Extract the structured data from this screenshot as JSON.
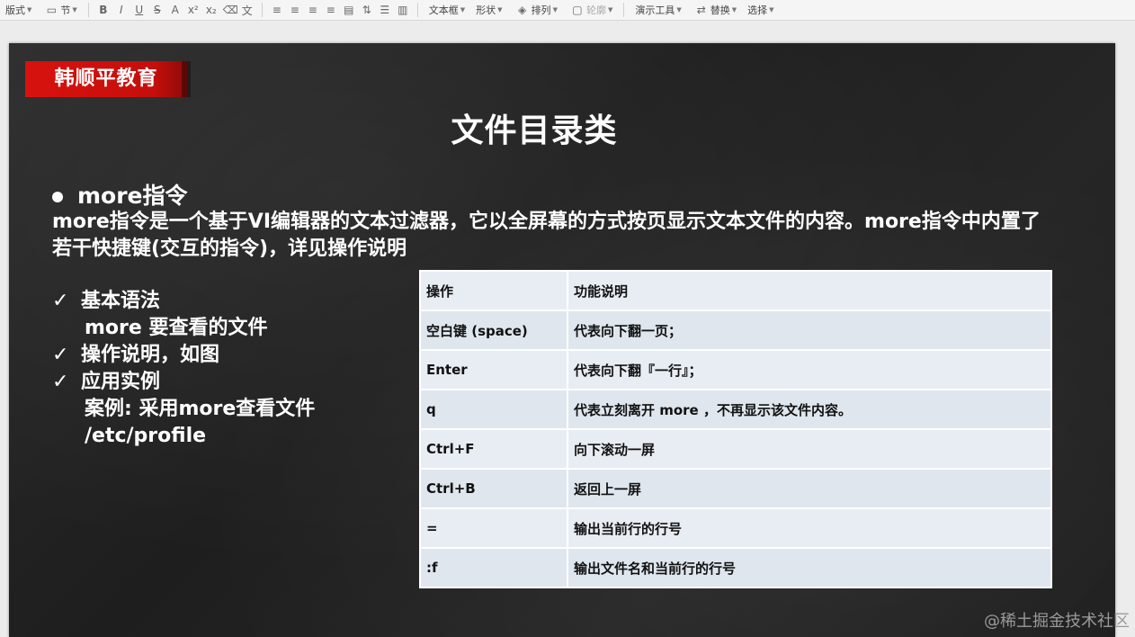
{
  "toolbar": {
    "items": [
      "版式",
      "节"
    ],
    "textbox": "文本框",
    "shape": "形状",
    "arrange": "排列",
    "outline": "轮廓",
    "present_tools": "演示工具",
    "replace": "替换",
    "select": "选择"
  },
  "slide": {
    "logo": "韩顺平教育",
    "title": "文件目录类",
    "heading": "more指令",
    "description": "more指令是一个基于VI编辑器的文本过滤器，它以全屏幕的方式按页显示文本文件的内容。more指令中内置了若干快捷键(交互的指令)，详见操作说明",
    "list": [
      {
        "check": "✓",
        "text": "基本语法"
      },
      {
        "check": "",
        "text": "more 要查看的文件"
      },
      {
        "check": "✓",
        "text": "操作说明，如图"
      },
      {
        "check": "✓",
        "text": "应用实例"
      },
      {
        "check": "",
        "text": "案例: 采用more查看文件"
      },
      {
        "check": "",
        "text": "/etc/profile"
      }
    ],
    "table": [
      [
        "操作",
        "功能说明"
      ],
      [
        "空白键 (space)",
        "代表向下翻一页；"
      ],
      [
        "Enter",
        "代表向下翻『一行』；"
      ],
      [
        "q",
        "代表立刻离开 more ，不再显示该文件内容。"
      ],
      [
        "Ctrl+F",
        "向下滚动一屏"
      ],
      [
        "Ctrl+B",
        "返回上一屏"
      ],
      [
        "=",
        "输出当前行的行号"
      ],
      [
        ":f",
        "输出文件名和当前行的行号"
      ]
    ]
  },
  "watermark": "@稀土掘金技术社区"
}
